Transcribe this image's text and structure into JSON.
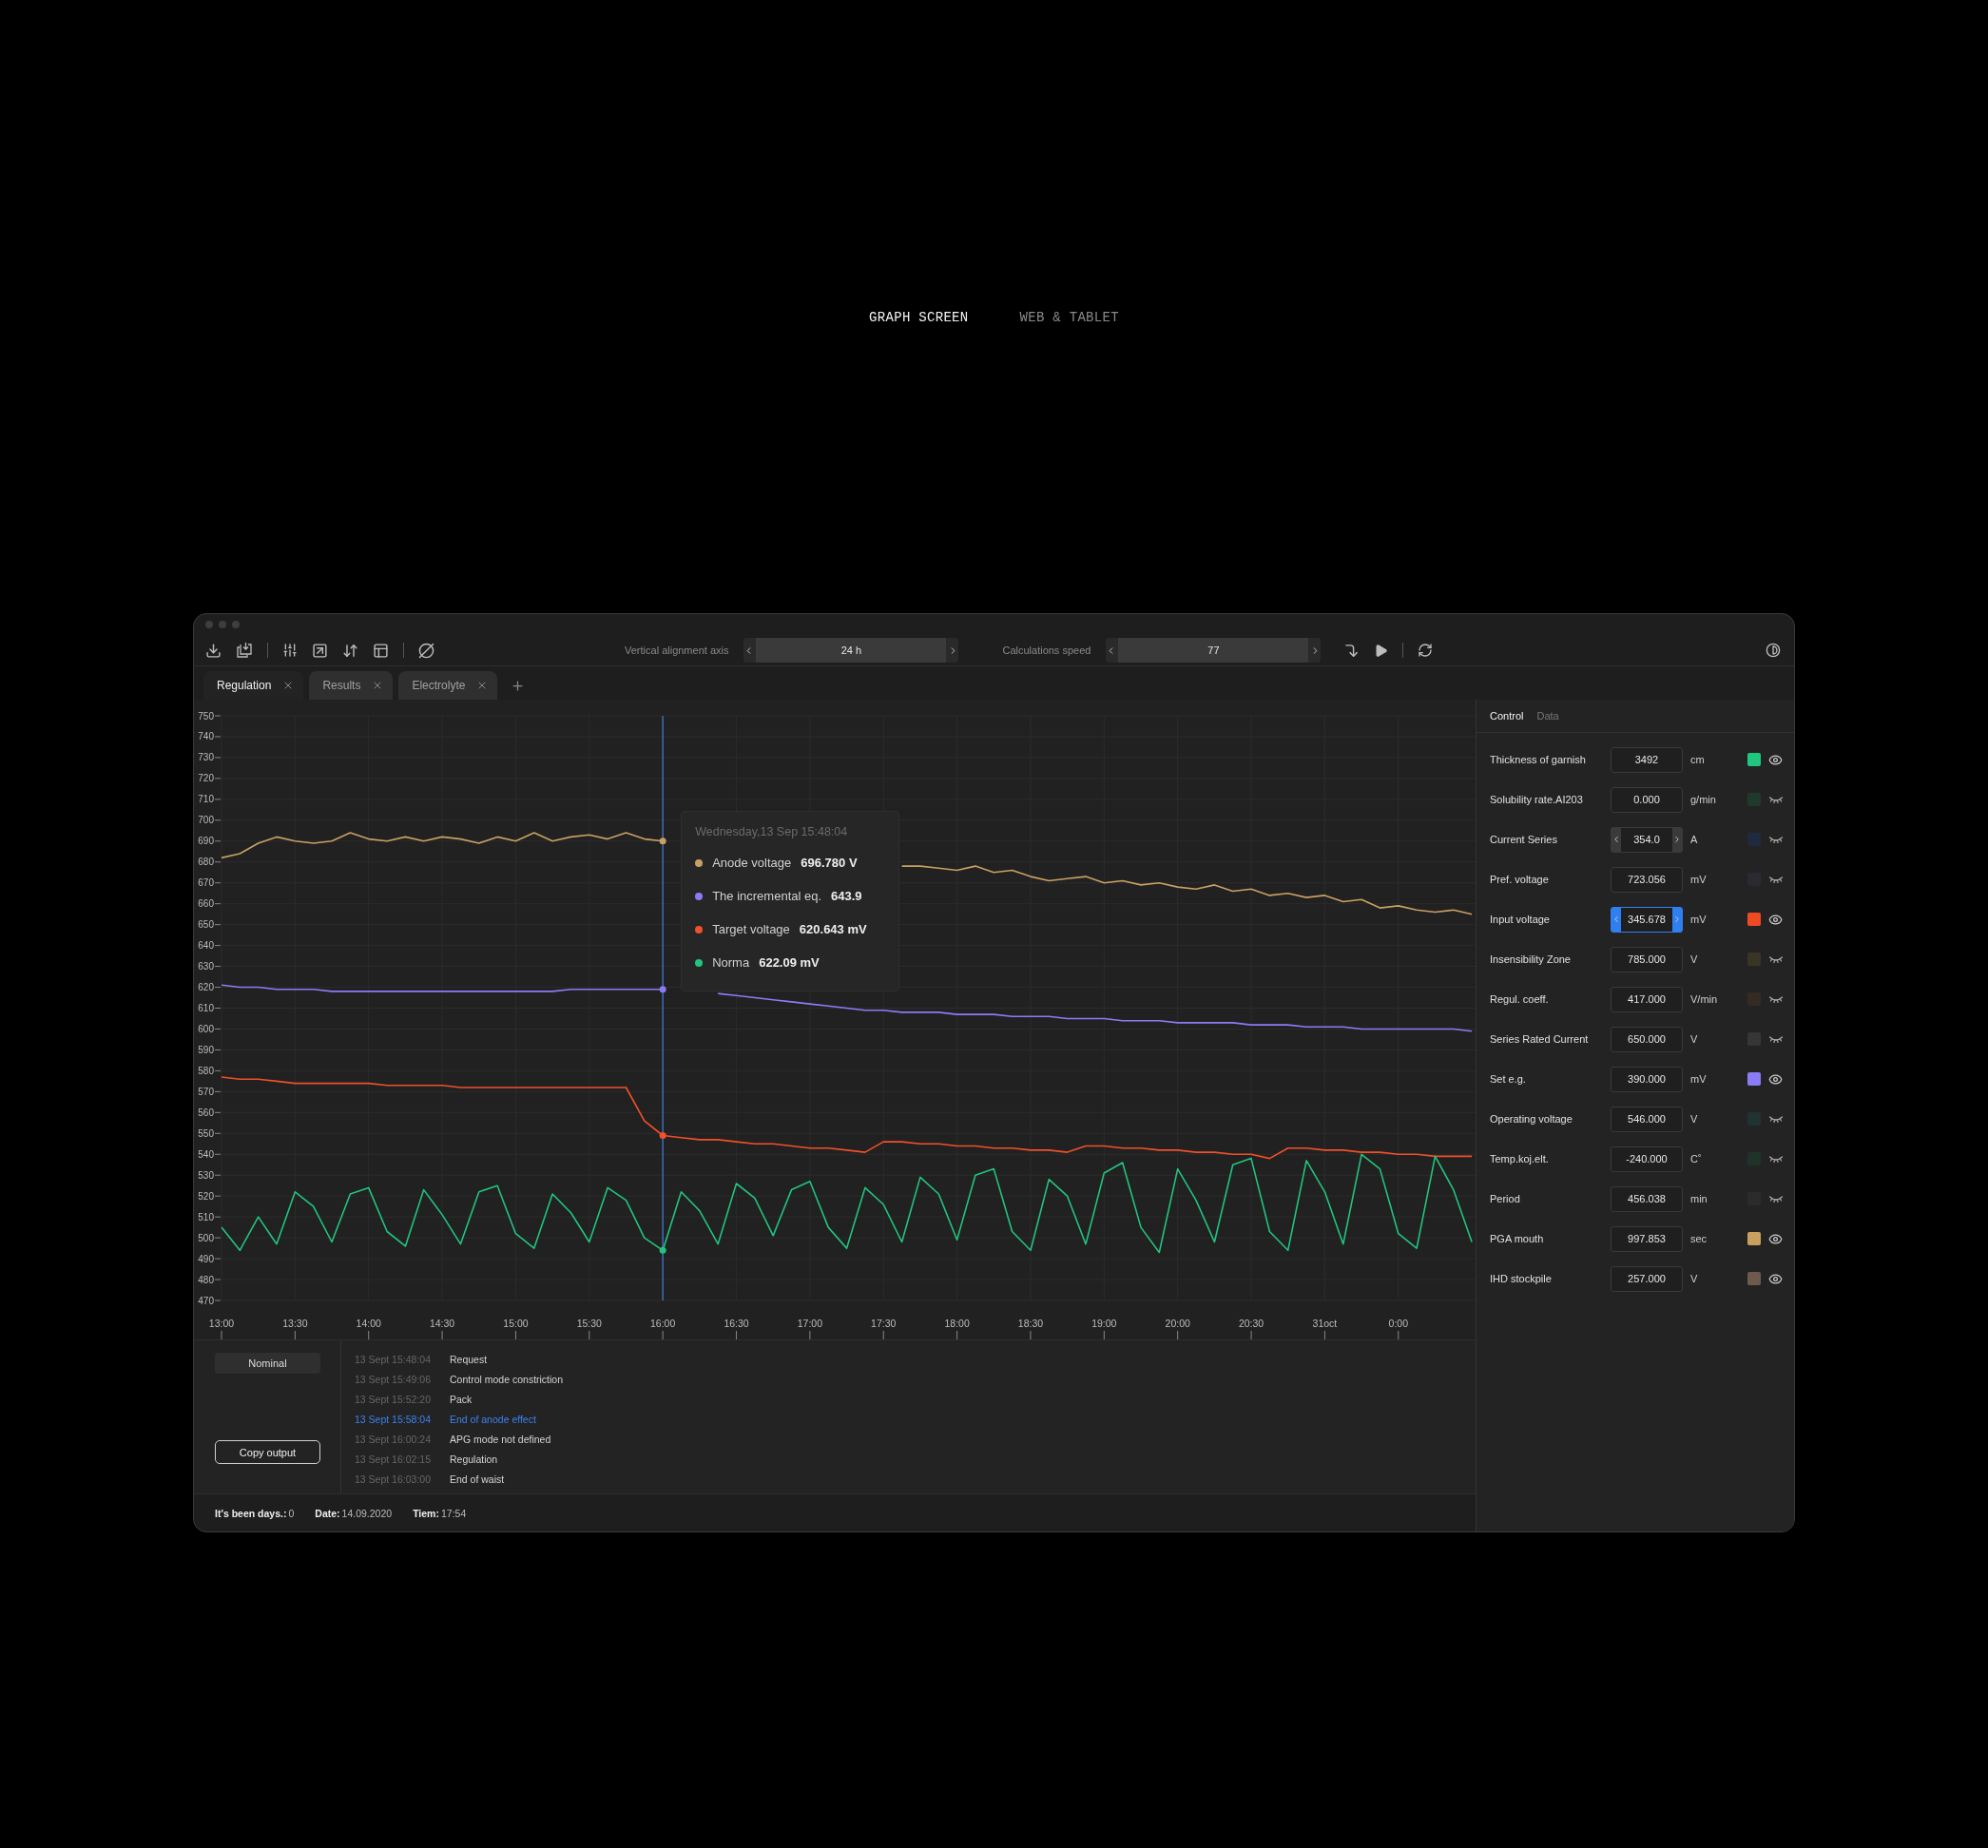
{
  "header": {
    "items": [
      {
        "label": "GRAPH SCREEN",
        "selected": true
      },
      {
        "label": "WEB & TABLET",
        "selected": false
      }
    ]
  },
  "toolbar": {
    "axis_label": "Vertical alignment axis",
    "axis_value": "24 h",
    "speed_label": "Calculations speed",
    "speed_value": "77"
  },
  "tabs": [
    {
      "label": "Regulation",
      "selected": true
    },
    {
      "label": "Results",
      "selected": false
    },
    {
      "label": "Electrolyte",
      "selected": false
    }
  ],
  "chart_data": {
    "type": "line",
    "grid": true,
    "ylim": [
      470,
      750
    ],
    "yticks": [
      750,
      740,
      730,
      720,
      710,
      700,
      690,
      680,
      670,
      660,
      650,
      640,
      630,
      620,
      610,
      600,
      590,
      580,
      570,
      560,
      550,
      540,
      530,
      520,
      510,
      500,
      490,
      480,
      470
    ],
    "categories": [
      "13:00",
      null,
      null,
      null,
      "13:30",
      null,
      null,
      null,
      "14:00",
      null,
      null,
      null,
      "14:30",
      null,
      null,
      null,
      "15:00",
      null,
      null,
      null,
      "15:30",
      null,
      null,
      null,
      "16:00",
      null,
      null,
      null,
      "16:30",
      null,
      null,
      null,
      "17:00",
      null,
      null,
      null,
      "17:30",
      null,
      null,
      null,
      "18:00",
      null,
      null,
      null,
      "18:30",
      null,
      null,
      null,
      "19:00",
      null,
      null,
      null,
      "20:00",
      null,
      null,
      null,
      "20:30",
      null,
      null,
      null,
      "31oct",
      null,
      null,
      null,
      "0:00",
      null,
      null,
      null,
      null
    ],
    "series": [
      {
        "name": "Anode voltage",
        "color": "#c9a063",
        "values": [
          682,
          684,
          689,
          692,
          690,
          689,
          690,
          694,
          691,
          690,
          692,
          690,
          692,
          691,
          689,
          692,
          690,
          694,
          690,
          692,
          693,
          691,
          694,
          691,
          690,
          null,
          null,
          null,
          null,
          null,
          null,
          null,
          null,
          null,
          null,
          null,
          null,
          678,
          678,
          677,
          676,
          678,
          675,
          676,
          673,
          671,
          672,
          673,
          670,
          671,
          669,
          670,
          668,
          667,
          669,
          666,
          667,
          664,
          665,
          663,
          664,
          661,
          662,
          658,
          659,
          657,
          656,
          657,
          655
        ]
      },
      {
        "name": "The incremental eq.",
        "color": "#8b7cf6",
        "values": [
          621,
          620,
          620,
          619,
          619,
          619,
          618,
          618,
          618,
          618,
          618,
          618,
          618,
          618,
          618,
          618,
          618,
          618,
          618,
          619,
          619,
          619,
          619,
          619,
          619,
          null,
          null,
          617,
          616,
          615,
          614,
          613,
          612,
          611,
          610,
          609,
          609,
          608,
          608,
          608,
          607,
          607,
          607,
          606,
          606,
          606,
          605,
          605,
          605,
          604,
          604,
          604,
          603,
          603,
          603,
          603,
          602,
          602,
          602,
          601,
          601,
          601,
          600,
          600,
          600,
          600,
          600,
          600,
          599
        ]
      },
      {
        "name": "Target voltage",
        "color": "#f0502a",
        "values": [
          577,
          576,
          576,
          575,
          574,
          574,
          574,
          574,
          574,
          573,
          573,
          573,
          573,
          572,
          572,
          572,
          572,
          572,
          572,
          572,
          572,
          572,
          572,
          556,
          549,
          548,
          547,
          547,
          546,
          545,
          545,
          544,
          543,
          543,
          542,
          541,
          546,
          546,
          545,
          545,
          544,
          544,
          543,
          543,
          542,
          542,
          541,
          544,
          544,
          543,
          543,
          542,
          542,
          541,
          541,
          540,
          540,
          538,
          543,
          543,
          542,
          542,
          541,
          541,
          540,
          540,
          539,
          539,
          539
        ]
      },
      {
        "name": "Norma",
        "color": "#22c47e",
        "values": [
          505,
          494,
          510,
          497,
          522,
          515,
          498,
          521,
          524,
          503,
          496,
          523,
          511,
          497,
          522,
          525,
          502,
          495,
          521,
          512,
          498,
          524,
          518,
          500,
          494,
          522,
          513,
          497,
          526,
          519,
          501,
          523,
          527,
          505,
          495,
          524,
          516,
          498,
          529,
          521,
          499,
          530,
          533,
          503,
          494,
          528,
          520,
          497,
          531,
          536,
          505,
          493,
          533,
          518,
          498,
          535,
          538,
          503,
          494,
          537,
          522,
          497,
          540,
          533,
          502,
          495,
          539,
          523,
          498
        ]
      }
    ],
    "annotations": [
      {
        "x": "16:00"
      }
    ]
  },
  "tooltip": {
    "title": "Wednesday,13 Sep 15:48:04",
    "values": [
      "696.780 V",
      "643.9",
      "620.643 mV",
      "622.09 mV"
    ]
  },
  "log": {
    "status": "Nominal",
    "copy_button": "Copy output",
    "entries": [
      {
        "time": "13 Sept 15:48:04",
        "text": "Request",
        "selected": false
      },
      {
        "time": "13 Sept 15:49:06",
        "text": "Control mode constriction",
        "selected": false
      },
      {
        "time": "13 Sept 15:52:20",
        "text": "Pack",
        "selected": false
      },
      {
        "time": "13 Sept 15:58:04",
        "text": "End of anode effect",
        "selected": true
      },
      {
        "time": "13 Sept 16:00:24",
        "text": "APG mode not defined",
        "selected": false
      },
      {
        "time": "13 Sept 16:02:15",
        "text": "Regulation",
        "selected": false
      },
      {
        "time": "13 Sept 16:03:00",
        "text": "End of waist",
        "selected": false
      }
    ]
  },
  "status_bar": [
    {
      "label": "It's been days.:",
      "value": "0"
    },
    {
      "label": "Date:",
      "value": "14.09.2020"
    },
    {
      "label": "Tiem:",
      "value": "17:54"
    }
  ],
  "panel": {
    "tabs": [
      {
        "label": "Control",
        "selected": true
      },
      {
        "label": "Data",
        "selected": false
      }
    ],
    "rows": [
      {
        "label": "Thickness of garnish",
        "kind": "input",
        "value": "3492",
        "unit": "cm",
        "color": "#1fc77e",
        "visible": true,
        "focused": false
      },
      {
        "label": "Solubility rate.AI203",
        "kind": "input",
        "value": "0.000",
        "unit": "g/min",
        "color": "#1e3a2c",
        "visible": false,
        "focused": false
      },
      {
        "label": "Current Series",
        "kind": "stepper",
        "value": "354.0",
        "unit": "A",
        "color": "#1f2a3e",
        "visible": false,
        "focused": false
      },
      {
        "label": "Pref. voltage",
        "kind": "input",
        "value": "723.056",
        "unit": "mV",
        "color": "#2a2a33",
        "visible": false,
        "focused": false
      },
      {
        "label": "Input voltage",
        "kind": "stepper",
        "value": "345.678",
        "unit": "mV",
        "color": "#f04a22",
        "visible": true,
        "focused": true
      },
      {
        "label": "Insensibility Zone",
        "kind": "input",
        "value": "785.000",
        "unit": "V",
        "color": "#3a3426",
        "visible": false,
        "focused": false
      },
      {
        "label": "Regul. coeff.",
        "kind": "input",
        "value": "417.000",
        "unit": "V/min",
        "color": "#352a24",
        "visible": false,
        "focused": false
      },
      {
        "label": "Series Rated Current",
        "kind": "input",
        "value": "650.000",
        "unit": "V",
        "color": "#383536",
        "visible": false,
        "focused": false
      },
      {
        "label": "Set e.g.",
        "kind": "input",
        "value": "390.000",
        "unit": "mV",
        "color": "#8b7cf6",
        "visible": true,
        "focused": false
      },
      {
        "label": "Operating voltage",
        "kind": "input",
        "value": "546.000",
        "unit": "V",
        "color": "#1f3432",
        "visible": false,
        "focused": false
      },
      {
        "label": "Temp.koj.elt.",
        "kind": "input",
        "value": "-240.000",
        "unit": "C˚",
        "color": "#1f3328",
        "visible": false,
        "focused": false
      },
      {
        "label": "Period",
        "kind": "input",
        "value": "456.038",
        "unit": "min",
        "color": "#2a2c2c",
        "visible": false,
        "focused": false
      },
      {
        "label": "PGA mouth",
        "kind": "input",
        "value": "997.853",
        "unit": "sec",
        "color": "#c9a060",
        "visible": true,
        "focused": false
      },
      {
        "label": "IHD stockpile",
        "kind": "input",
        "value": "257.000",
        "unit": "V",
        "color": "#6e5a4c",
        "visible": true,
        "focused": false
      }
    ]
  }
}
